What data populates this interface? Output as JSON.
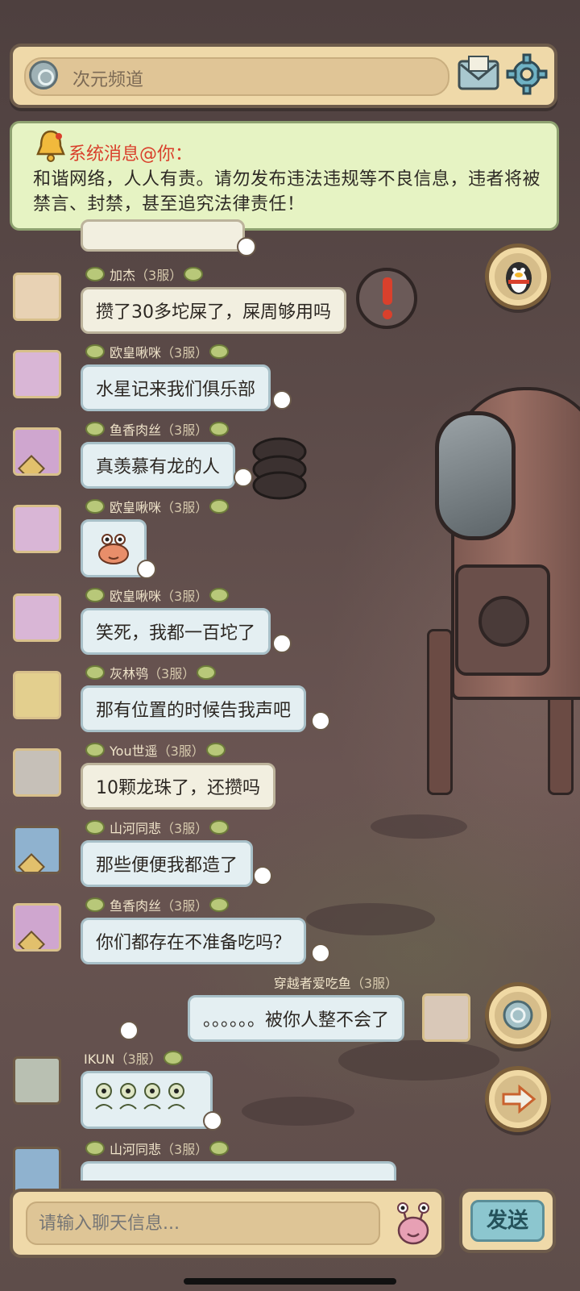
{
  "header": {
    "channel_name": "次元频道",
    "mail_icon": "mail-icon",
    "settings_icon": "gear-icon"
  },
  "notice": {
    "icon": "bell-icon",
    "title": "系统消息@你：",
    "body": "和谐网络，人人有责。请勿发布违法违规等不良信息，违者将被禁言、封禁，甚至追究法律责任！"
  },
  "messages": [
    {
      "name": "加杰",
      "server": "（3服）",
      "text": "攒了30多坨屎了，屎周够用吗"
    },
    {
      "name": "欧皇啾咪",
      "server": "（3服）",
      "text": "水星记来我们俱乐部"
    },
    {
      "name": "鱼香肉丝",
      "server": "（3服）",
      "text": "真羡慕有龙的人"
    },
    {
      "name": "欧皇啾咪",
      "server": "（3服）",
      "text": "",
      "sticker": "crab-sticker-icon"
    },
    {
      "name": "欧皇啾咪",
      "server": "（3服）",
      "text": "笑死，我都一百坨了"
    },
    {
      "name": "灰林鸮",
      "server": "（3服）",
      "text": "那有位置的时候告我声吧"
    },
    {
      "name": "You世遥",
      "server": "（3服）",
      "text": "10颗龙珠了，还攒吗"
    },
    {
      "name": "山河同悲",
      "server": "（3服）",
      "text": "那些便便我都造了"
    },
    {
      "name": "鱼香肉丝",
      "server": "（3服）",
      "text": "你们都存在不准备吃吗？"
    },
    {
      "name": "穿越者爱吃鱼",
      "server": "（3服）",
      "text": "。。。。。。被你人整不会了"
    },
    {
      "name": "IKUN",
      "server": "（3服）",
      "text": "",
      "sticker": "eyeball-sticker-icon"
    },
    {
      "name": "山河同悲",
      "server": "（3服）",
      "text": ""
    }
  ],
  "input": {
    "placeholder": "请输入聊天信息...",
    "send_label": "发送"
  },
  "colors": {
    "panel": "#efd9a9",
    "panel_border": "#6d5b4b",
    "notice_bg": "#e6f3c3",
    "notice_title": "#d9402c",
    "send_button": "#8cc6cf"
  }
}
